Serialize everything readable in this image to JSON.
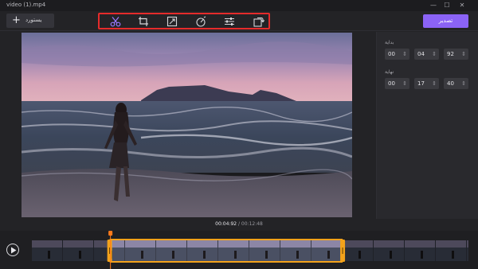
{
  "window": {
    "title": "video (1).mp4",
    "minimize_glyph": "—",
    "maximize_glyph": "☐",
    "close_glyph": "✕"
  },
  "toolbar": {
    "import_glyph": "+",
    "import_label": "يستورد",
    "export_label": "تصدير",
    "tools": [
      {
        "name": "trim-icon",
        "active": true
      },
      {
        "name": "crop-icon",
        "active": false
      },
      {
        "name": "watermark-icon",
        "active": false
      },
      {
        "name": "speed-icon",
        "active": false
      },
      {
        "name": "adjust-icon",
        "active": false
      },
      {
        "name": "rotate-icon",
        "active": false
      }
    ]
  },
  "trim_panel": {
    "start_label": "بداية",
    "end_label": "نهاية",
    "start": {
      "h": "00",
      "m": "04",
      "s": "92"
    },
    "end": {
      "h": "00",
      "m": "17",
      "s": "40"
    },
    "spin_glyph": "⇕"
  },
  "playback": {
    "current": "00:04:92",
    "separator": " / ",
    "total": "00:12:48",
    "selection_start_fraction": 0.18,
    "selection_end_fraction": 0.71,
    "playhead_fraction": 0.18
  },
  "colors": {
    "accent": "#8b63f6",
    "trim_handle": "#f3a21b",
    "highlight_frame": "#e52b2b",
    "playhead": "#ff7a1a"
  }
}
